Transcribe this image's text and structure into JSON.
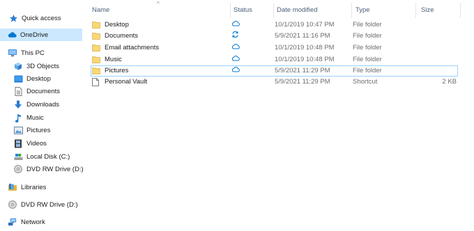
{
  "navigation": {
    "quick_access": "Quick access",
    "onedrive": "OneDrive",
    "this_pc": "This PC",
    "objects_3d": "3D Objects",
    "desktop": "Desktop",
    "documents": "Documents",
    "downloads": "Downloads",
    "music": "Music",
    "pictures": "Pictures",
    "videos": "Videos",
    "local_disk": "Local Disk (C:)",
    "dvd_drive_pc": "DVD RW Drive (D:)",
    "libraries": "Libraries",
    "dvd_drive": "DVD RW Drive (D:)",
    "network": "Network"
  },
  "columns": {
    "name": "Name",
    "status": "Status",
    "date_modified": "Date modified",
    "type": "Type",
    "size": "Size"
  },
  "files": [
    {
      "name": "Desktop",
      "status": "cloud",
      "date": "10/1/2019 10:47 PM",
      "type": "File folder",
      "size": ""
    },
    {
      "name": "Documents",
      "status": "sync",
      "date": "5/9/2021 11:16 PM",
      "type": "File folder",
      "size": ""
    },
    {
      "name": "Email attachments",
      "status": "cloud",
      "date": "10/1/2019 10:48 PM",
      "type": "File folder",
      "size": ""
    },
    {
      "name": "Music",
      "status": "cloud",
      "date": "10/1/2019 10:48 PM",
      "type": "File folder",
      "size": ""
    },
    {
      "name": "Pictures",
      "status": "cloud",
      "date": "5/9/2021 11:29 PM",
      "type": "File folder",
      "size": ""
    },
    {
      "name": "Personal Vault",
      "status": "",
      "date": "5/9/2021 11:29 PM",
      "type": "Shortcut",
      "size": "2 KB"
    }
  ],
  "colors": {
    "selected_nav": "#cce8ff",
    "folder": "#f8d775",
    "onedrive_blue": "#0078d4"
  }
}
